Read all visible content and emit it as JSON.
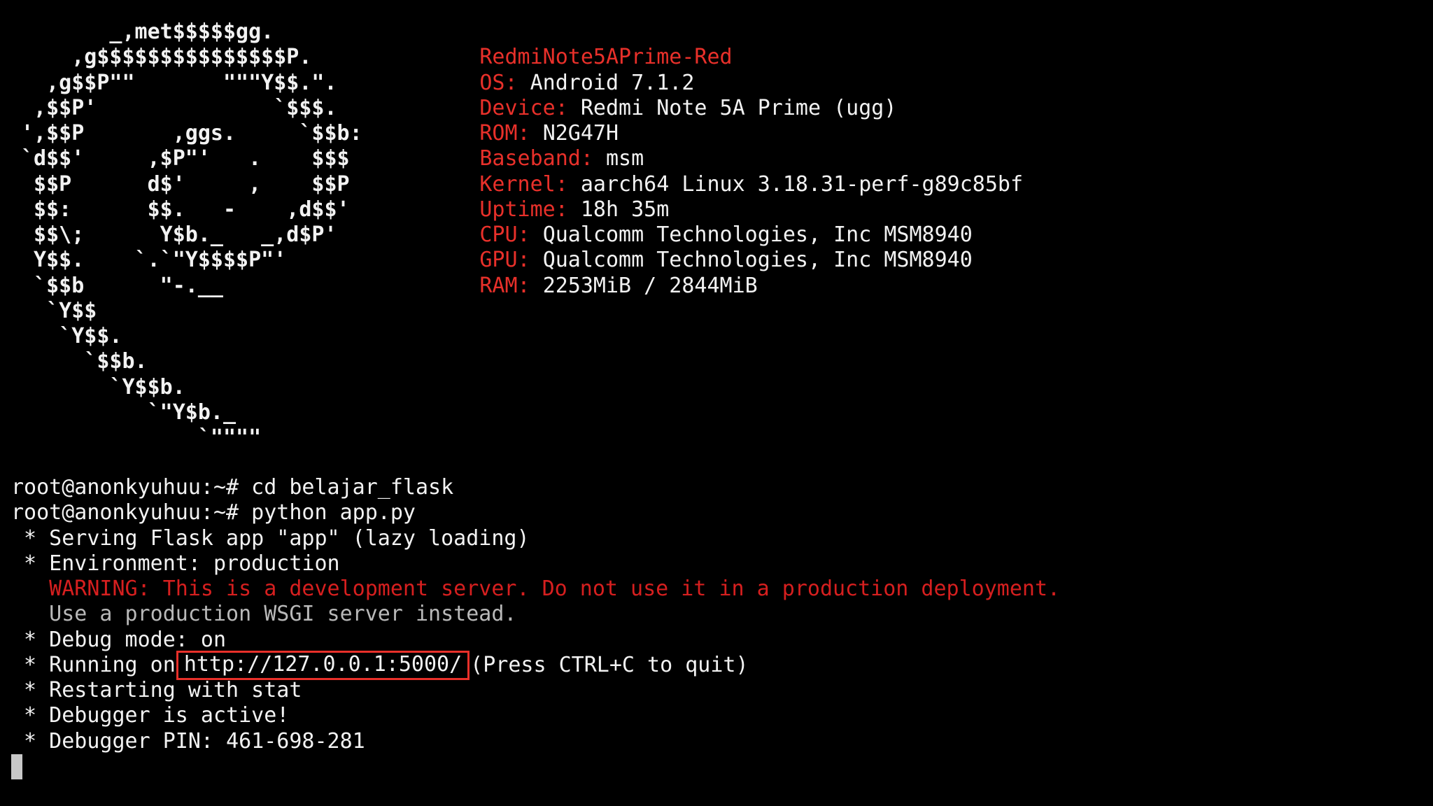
{
  "logo": {
    "lines": [
      "       _,met$$$$$gg.",
      "    ,g$$$$$$$$$$$$$$$P.",
      "  ,g$$P\"\"       \"\"\"Y$$.\".",
      " ,$$P'              `$$$.",
      "',$$P       ,ggs.     `$$b:",
      "`d$$'     ,$P\"'   .    $$$",
      " $$P      d$'     ,    $$P",
      " $$:      $$.   -    ,d$$'",
      " $$\\;      Y$b._   _,d$P'",
      " Y$$.    `.`\"Y$$$$P\"'",
      " `$$b      \"-.__",
      "  `Y$$",
      "   `Y$$.",
      "     `$$b.",
      "       `Y$$b.",
      "          `\"Y$b._",
      "              `\"\"\"\""
    ]
  },
  "sysinfo": {
    "hostname": "RedmiNote5APrime-Red",
    "os_label": "OS:",
    "os_value": "Android 7.1.2",
    "device_label": "Device:",
    "device_value": "Redmi Note 5A Prime (ugg)",
    "rom_label": "ROM:",
    "rom_value": "N2G47H",
    "baseband_label": "Baseband:",
    "baseband_value": "msm",
    "kernel_label": "Kernel:",
    "kernel_value": "aarch64 Linux 3.18.31-perf-g89c85bf",
    "uptime_label": "Uptime:",
    "uptime_value": "18h 35m",
    "cpu_label": "CPU:",
    "cpu_value": "Qualcomm Technologies, Inc MSM8940",
    "gpu_label": "GPU:",
    "gpu_value": "Qualcomm Technologies, Inc MSM8940",
    "ram_label": "RAM:",
    "ram_value": "2253MiB / 2844MiB"
  },
  "terminal": {
    "prompt": "root@anonkyuhuu:~#",
    "cmd1": "cd belajar_flask",
    "cmd2": "python app.py",
    "serving": " * Serving Flask app \"app\" (lazy loading)",
    "environment": " * Environment: production",
    "warning": "   WARNING: This is a development server. Do not use it in a production deployment.",
    "warning_hint": "   Use a production WSGI server instead.",
    "debug_mode": " * Debug mode: on",
    "running_prefix": " * Running on",
    "running_url": "http://127.0.0.1:5000/",
    "running_suffix": "(Press CTRL+C to quit)",
    "restarting": " * Restarting with stat",
    "debugger_active": " * Debugger is active!",
    "debugger_pin": " * Debugger PIN: 461-698-281"
  },
  "colors": {
    "background": "#000000",
    "text": "#f2f2f2",
    "accent_red": "#e8302a",
    "dim_text": "#b9b9b9"
  }
}
